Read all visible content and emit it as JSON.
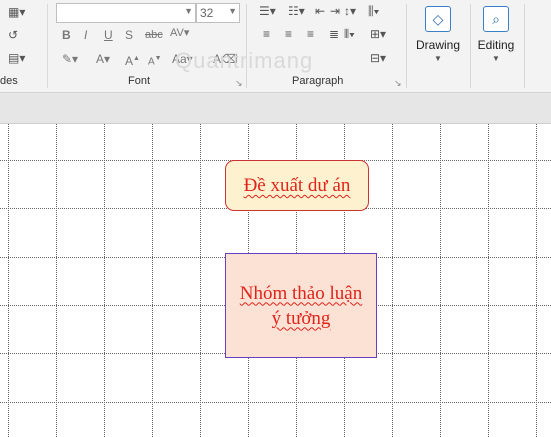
{
  "ribbon": {
    "groups": {
      "slides_label": "des",
      "font_label": "Font",
      "paragraph_label": "Paragraph"
    },
    "font": {
      "font_name_value": "",
      "font_size_value": "32"
    },
    "drawing_label": "Drawing",
    "editing_label": "Editing",
    "watermark": "Quantrimang"
  },
  "canvas": {
    "shape1_text": "Đề xuất dư án",
    "shape2_line1": "Nhóm thảo luận",
    "shape2_line2": "ý tưởng"
  },
  "colors": {
    "shape_text": "#e0241b",
    "shape1_fill": "#fdf1cf",
    "shape1_border": "#cc3333",
    "shape2_fill": "#fbe2d5",
    "shape2_border": "#6a3fbf"
  }
}
